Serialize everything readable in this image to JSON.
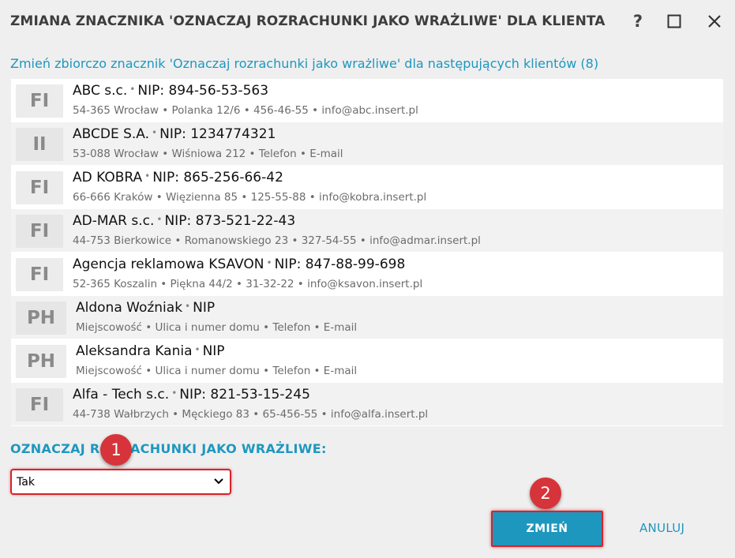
{
  "window": {
    "title": "ZMIANA ZNACZNIKA 'OZNACZAJ ROZRACHUNKI JAKO WRAŻLIWE' DLA KLIENTA",
    "help_label": "?"
  },
  "subtitle": "Zmień zbiorczo znacznik 'Oznaczaj rozrachunki jako wrażliwe' dla następujących klientów (8)",
  "clients": [
    {
      "badge": "FI",
      "name": "ABC s.c.",
      "nip": "NIP: 894-56-53-563",
      "details": "54-365 Wrocław • Polanka  12/6  • 456-46-55 • info@abc.insert.pl"
    },
    {
      "badge": "II",
      "name": "ABCDE S.A.",
      "nip": "NIP: 1234774321",
      "details": "53-088 Wrocław • Wiśniowa 212 • Telefon • E-mail"
    },
    {
      "badge": "FI",
      "name": "AD KOBRA",
      "nip": "NIP: 865-256-66-42",
      "details": "66-666 Kraków • Więzienna  85  • 125-55-88 • info@kobra.insert.pl"
    },
    {
      "badge": "FI",
      "name": "AD-MAR s.c.",
      "nip": "NIP: 873-521-22-43",
      "details": "44-753 Bierkowice • Romanowskiego 23  • 327-54-55 • info@admar.insert.pl"
    },
    {
      "badge": "FI",
      "name": "Agencja reklamowa KSAVON",
      "nip": "NIP: 847-88-99-698",
      "details": "52-365 Koszalin • Piękna  44/2  • 31-32-22 • info@ksavon.insert.pl"
    },
    {
      "badge": "PH",
      "name": "Aldona Woźniak",
      "nip": "NIP",
      "details": "Miejscowość • Ulica i numer domu • Telefon • E-mail"
    },
    {
      "badge": "PH",
      "name": "Aleksandra Kania",
      "nip": "NIP",
      "details": "Miejscowość • Ulica i numer domu • Telefon • E-mail"
    },
    {
      "badge": "FI",
      "name": "Alfa - Tech s.c.",
      "nip": "NIP: 821-53-15-245",
      "details": "44-738 Wałbrzych • Męckiego  83  • 65-456-55 • info@alfa.insert.pl"
    }
  ],
  "field": {
    "label": "OZNACZAJ ROZRACHUNKI JAKO WRAŻLIWE:",
    "selected": "Tak"
  },
  "markers": [
    "1",
    "2"
  ],
  "actions": {
    "confirm": "ZMIEŃ",
    "cancel": "ANULUJ"
  },
  "colors": {
    "accent": "#1e97bf",
    "highlight": "#d6242c"
  }
}
